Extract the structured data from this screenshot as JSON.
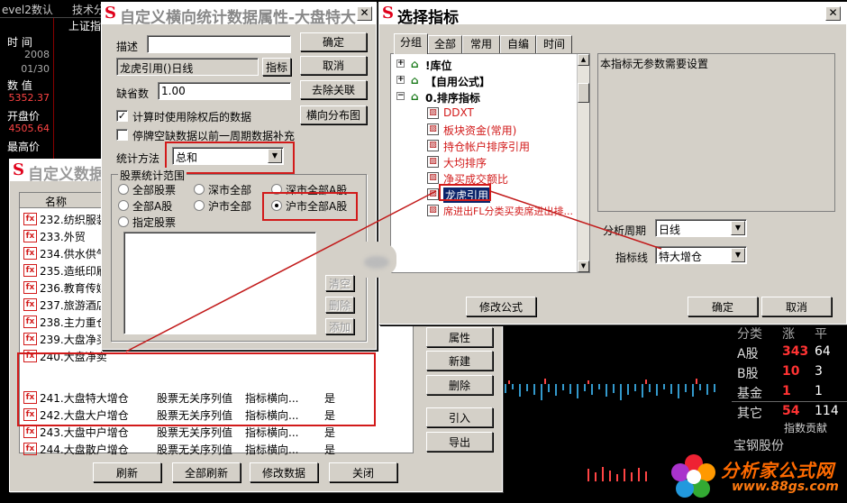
{
  "background": {
    "toolbar": [
      "evel2数认",
      "技术分",
      "上证指"
    ],
    "left_panel": [
      {
        "label": "时 间",
        "value": "2008",
        "value2": "01/30"
      },
      {
        "label": "数 值",
        "value": "5352.37"
      },
      {
        "label": "开盘价",
        "value": "4505.64"
      },
      {
        "label": "最高价",
        "value": ""
      }
    ],
    "right_table": [
      {
        "cat": "分类",
        "a": "涨",
        "b": "平"
      },
      {
        "cat": "A股",
        "a": "343",
        "b": "64"
      },
      {
        "cat": "B股",
        "a": "10",
        "b": "3"
      },
      {
        "cat": "基金",
        "a": "1",
        "b": "1"
      },
      {
        "cat": "其它",
        "a": "54",
        "b": "114"
      }
    ],
    "index_contrib": "指数贡献",
    "stock_name": "宝钢股份",
    "watermark": {
      "title": "分析家公式网",
      "url": "www.88gs.com"
    }
  },
  "list_dialog": {
    "title": "自定义数据",
    "column_name": "名称",
    "rows": [
      "232.纺织服装",
      "233.外贸",
      "234.供水供气",
      "235.造纸印刷",
      "236.教育传媒",
      "237.旅游酒店",
      "238.主力重仓",
      "239.大盘净买",
      "240.大盘净卖"
    ],
    "highlighted_rows": [
      {
        "name": "241.大盘特大增仓",
        "seq": "股票无关序列值",
        "type": "指标横向...",
        "flag": "是"
      },
      {
        "name": "242.大盘大户增仓",
        "seq": "股票无关序列值",
        "type": "指标横向...",
        "flag": "是"
      },
      {
        "name": "243.大盘中户增仓",
        "seq": "股票无关序列值",
        "type": "指标横向...",
        "flag": "是"
      },
      {
        "name": "244.大盘散户增仓",
        "seq": "股票无关序列值",
        "type": "指标横向...",
        "flag": "是"
      }
    ],
    "side_buttons": [
      "属性",
      "新建",
      "删除",
      "引入",
      "导出"
    ],
    "bottom_buttons": [
      "刷新",
      "全部刷新",
      "修改数据",
      "关闭"
    ]
  },
  "props_dialog": {
    "title": "自定义横向统计数据属性-大盘特大增仓",
    "desc_label": "描述",
    "desc_value": "",
    "indicator_value": "龙虎引用()日线",
    "indicator_button": "指标",
    "default_label": "缺省数",
    "default_value": "1.00",
    "check1": "计算时使用除权后的数据",
    "check2": "停牌空缺数据以前一周期数据补充",
    "stat_method_label": "统计方法",
    "stat_method_value": "总和",
    "group_label": "股票统计范围",
    "radios": [
      "全部股票",
      "深市全部",
      "深市全部A股",
      "全部A股",
      "沪市全部",
      "沪市全部A股",
      "指定股票"
    ],
    "buttons": [
      "确定",
      "取消",
      "去除关联",
      "横向分布图"
    ],
    "list_buttons": [
      "清空",
      "删除",
      "添加"
    ]
  },
  "select_dialog": {
    "title": "选择指标",
    "tabs": [
      "分组",
      "全部",
      "常用",
      "自编",
      "时间"
    ],
    "tree_groups": [
      "!库位",
      "【自用公式】",
      "0.排序指标"
    ],
    "tree_items": [
      "DDXT",
      "板块资金(常用)",
      "持仓帐户排序引用",
      "大均排序",
      "净买成交额比",
      "龙虎引用",
      "席进出FL分类买卖席进出排..."
    ],
    "selected_item": "龙虎引用",
    "info_text": "本指标无参数需要设置",
    "period_label": "分析周期",
    "period_value": "日线",
    "line_label": "指标线",
    "line_value": "特大增仓",
    "modify_button": "修改公式",
    "ok_button": "确定",
    "cancel_button": "取消"
  }
}
